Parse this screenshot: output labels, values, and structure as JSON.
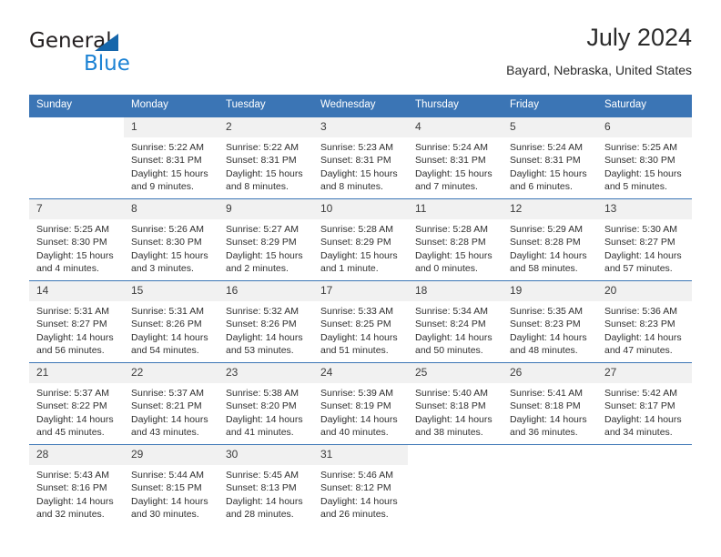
{
  "logo": {
    "word1": "General",
    "word2": "Blue",
    "triangle_color": "#1566ab",
    "blue_text_color": "#1c82d4"
  },
  "header": {
    "title": "July 2024",
    "subtitle": "Bayard, Nebraska, United States",
    "accent_color": "#3b75b5"
  },
  "calendar": {
    "weekday_headers": [
      "Sunday",
      "Monday",
      "Tuesday",
      "Wednesday",
      "Thursday",
      "Friday",
      "Saturday"
    ],
    "weeks": [
      [
        {
          "day": "",
          "sunrise": "",
          "sunset": "",
          "daylight1": "",
          "daylight2": ""
        },
        {
          "day": "1",
          "sunrise": "Sunrise: 5:22 AM",
          "sunset": "Sunset: 8:31 PM",
          "daylight1": "Daylight: 15 hours",
          "daylight2": "and 9 minutes."
        },
        {
          "day": "2",
          "sunrise": "Sunrise: 5:22 AM",
          "sunset": "Sunset: 8:31 PM",
          "daylight1": "Daylight: 15 hours",
          "daylight2": "and 8 minutes."
        },
        {
          "day": "3",
          "sunrise": "Sunrise: 5:23 AM",
          "sunset": "Sunset: 8:31 PM",
          "daylight1": "Daylight: 15 hours",
          "daylight2": "and 8 minutes."
        },
        {
          "day": "4",
          "sunrise": "Sunrise: 5:24 AM",
          "sunset": "Sunset: 8:31 PM",
          "daylight1": "Daylight: 15 hours",
          "daylight2": "and 7 minutes."
        },
        {
          "day": "5",
          "sunrise": "Sunrise: 5:24 AM",
          "sunset": "Sunset: 8:31 PM",
          "daylight1": "Daylight: 15 hours",
          "daylight2": "and 6 minutes."
        },
        {
          "day": "6",
          "sunrise": "Sunrise: 5:25 AM",
          "sunset": "Sunset: 8:30 PM",
          "daylight1": "Daylight: 15 hours",
          "daylight2": "and 5 minutes."
        }
      ],
      [
        {
          "day": "7",
          "sunrise": "Sunrise: 5:25 AM",
          "sunset": "Sunset: 8:30 PM",
          "daylight1": "Daylight: 15 hours",
          "daylight2": "and 4 minutes."
        },
        {
          "day": "8",
          "sunrise": "Sunrise: 5:26 AM",
          "sunset": "Sunset: 8:30 PM",
          "daylight1": "Daylight: 15 hours",
          "daylight2": "and 3 minutes."
        },
        {
          "day": "9",
          "sunrise": "Sunrise: 5:27 AM",
          "sunset": "Sunset: 8:29 PM",
          "daylight1": "Daylight: 15 hours",
          "daylight2": "and 2 minutes."
        },
        {
          "day": "10",
          "sunrise": "Sunrise: 5:28 AM",
          "sunset": "Sunset: 8:29 PM",
          "daylight1": "Daylight: 15 hours",
          "daylight2": "and 1 minute."
        },
        {
          "day": "11",
          "sunrise": "Sunrise: 5:28 AM",
          "sunset": "Sunset: 8:28 PM",
          "daylight1": "Daylight: 15 hours",
          "daylight2": "and 0 minutes."
        },
        {
          "day": "12",
          "sunrise": "Sunrise: 5:29 AM",
          "sunset": "Sunset: 8:28 PM",
          "daylight1": "Daylight: 14 hours",
          "daylight2": "and 58 minutes."
        },
        {
          "day": "13",
          "sunrise": "Sunrise: 5:30 AM",
          "sunset": "Sunset: 8:27 PM",
          "daylight1": "Daylight: 14 hours",
          "daylight2": "and 57 minutes."
        }
      ],
      [
        {
          "day": "14",
          "sunrise": "Sunrise: 5:31 AM",
          "sunset": "Sunset: 8:27 PM",
          "daylight1": "Daylight: 14 hours",
          "daylight2": "and 56 minutes."
        },
        {
          "day": "15",
          "sunrise": "Sunrise: 5:31 AM",
          "sunset": "Sunset: 8:26 PM",
          "daylight1": "Daylight: 14 hours",
          "daylight2": "and 54 minutes."
        },
        {
          "day": "16",
          "sunrise": "Sunrise: 5:32 AM",
          "sunset": "Sunset: 8:26 PM",
          "daylight1": "Daylight: 14 hours",
          "daylight2": "and 53 minutes."
        },
        {
          "day": "17",
          "sunrise": "Sunrise: 5:33 AM",
          "sunset": "Sunset: 8:25 PM",
          "daylight1": "Daylight: 14 hours",
          "daylight2": "and 51 minutes."
        },
        {
          "day": "18",
          "sunrise": "Sunrise: 5:34 AM",
          "sunset": "Sunset: 8:24 PM",
          "daylight1": "Daylight: 14 hours",
          "daylight2": "and 50 minutes."
        },
        {
          "day": "19",
          "sunrise": "Sunrise: 5:35 AM",
          "sunset": "Sunset: 8:23 PM",
          "daylight1": "Daylight: 14 hours",
          "daylight2": "and 48 minutes."
        },
        {
          "day": "20",
          "sunrise": "Sunrise: 5:36 AM",
          "sunset": "Sunset: 8:23 PM",
          "daylight1": "Daylight: 14 hours",
          "daylight2": "and 47 minutes."
        }
      ],
      [
        {
          "day": "21",
          "sunrise": "Sunrise: 5:37 AM",
          "sunset": "Sunset: 8:22 PM",
          "daylight1": "Daylight: 14 hours",
          "daylight2": "and 45 minutes."
        },
        {
          "day": "22",
          "sunrise": "Sunrise: 5:37 AM",
          "sunset": "Sunset: 8:21 PM",
          "daylight1": "Daylight: 14 hours",
          "daylight2": "and 43 minutes."
        },
        {
          "day": "23",
          "sunrise": "Sunrise: 5:38 AM",
          "sunset": "Sunset: 8:20 PM",
          "daylight1": "Daylight: 14 hours",
          "daylight2": "and 41 minutes."
        },
        {
          "day": "24",
          "sunrise": "Sunrise: 5:39 AM",
          "sunset": "Sunset: 8:19 PM",
          "daylight1": "Daylight: 14 hours",
          "daylight2": "and 40 minutes."
        },
        {
          "day": "25",
          "sunrise": "Sunrise: 5:40 AM",
          "sunset": "Sunset: 8:18 PM",
          "daylight1": "Daylight: 14 hours",
          "daylight2": "and 38 minutes."
        },
        {
          "day": "26",
          "sunrise": "Sunrise: 5:41 AM",
          "sunset": "Sunset: 8:18 PM",
          "daylight1": "Daylight: 14 hours",
          "daylight2": "and 36 minutes."
        },
        {
          "day": "27",
          "sunrise": "Sunrise: 5:42 AM",
          "sunset": "Sunset: 8:17 PM",
          "daylight1": "Daylight: 14 hours",
          "daylight2": "and 34 minutes."
        }
      ],
      [
        {
          "day": "28",
          "sunrise": "Sunrise: 5:43 AM",
          "sunset": "Sunset: 8:16 PM",
          "daylight1": "Daylight: 14 hours",
          "daylight2": "and 32 minutes."
        },
        {
          "day": "29",
          "sunrise": "Sunrise: 5:44 AM",
          "sunset": "Sunset: 8:15 PM",
          "daylight1": "Daylight: 14 hours",
          "daylight2": "and 30 minutes."
        },
        {
          "day": "30",
          "sunrise": "Sunrise: 5:45 AM",
          "sunset": "Sunset: 8:13 PM",
          "daylight1": "Daylight: 14 hours",
          "daylight2": "and 28 minutes."
        },
        {
          "day": "31",
          "sunrise": "Sunrise: 5:46 AM",
          "sunset": "Sunset: 8:12 PM",
          "daylight1": "Daylight: 14 hours",
          "daylight2": "and 26 minutes."
        },
        {
          "day": "",
          "sunrise": "",
          "sunset": "",
          "daylight1": "",
          "daylight2": ""
        },
        {
          "day": "",
          "sunrise": "",
          "sunset": "",
          "daylight1": "",
          "daylight2": ""
        },
        {
          "day": "",
          "sunrise": "",
          "sunset": "",
          "daylight1": "",
          "daylight2": ""
        }
      ]
    ]
  }
}
